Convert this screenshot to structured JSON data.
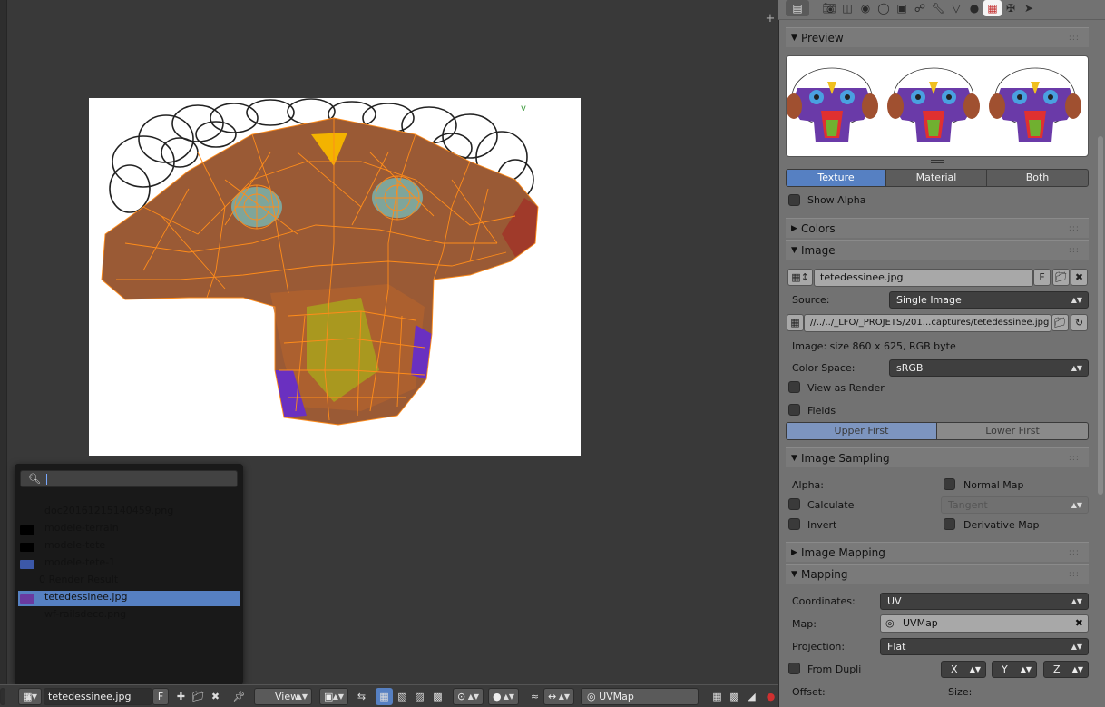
{
  "popup": {
    "items": [
      {
        "label": "doc20161215140459.png",
        "thumb": "none"
      },
      {
        "label": "modele-terrain",
        "thumb": "#000000"
      },
      {
        "label": "modele-tete",
        "thumb": "#000000"
      },
      {
        "label": "modele-tete-1",
        "thumb": "#3c58a8"
      },
      {
        "label": "0 Render Result",
        "thumb": "none"
      },
      {
        "label": "tetedessinee.jpg",
        "thumb": "#6a3aa0",
        "selected": true
      },
      {
        "label": "wf-railsdeco.png",
        "thumb": "none"
      }
    ]
  },
  "header": {
    "image_name": "tetedessinee.jpg",
    "fake_user": "F",
    "view_menu": "View",
    "uv_map": "UVMap"
  },
  "props": {
    "preview": {
      "title": "Preview",
      "tabs": [
        "Texture",
        "Material",
        "Both"
      ],
      "show_alpha": "Show Alpha"
    },
    "colors": {
      "title": "Colors"
    },
    "image": {
      "title": "Image",
      "name": "tetedessinee.jpg",
      "fake_user": "F",
      "source_label": "Source:",
      "source_value": "Single Image",
      "filepath": "//../../_LFO/_PROJETS/201...captures/tetedessinee.jpg",
      "info": "Image: size 860 x 625, RGB byte",
      "color_space_label": "Color Space:",
      "color_space_value": "sRGB",
      "view_as_render": "View as Render",
      "fields": "Fields",
      "field_order": [
        "Upper First",
        "Lower First"
      ]
    },
    "image_sampling": {
      "title": "Image Sampling",
      "alpha_label": "Alpha:",
      "normal_map": "Normal Map",
      "calculate": "Calculate",
      "tangent": "Tangent",
      "invert": "Invert",
      "derivative_map": "Derivative Map"
    },
    "image_mapping": {
      "title": "Image Mapping"
    },
    "mapping": {
      "title": "Mapping",
      "coordinates_label": "Coordinates:",
      "coordinates_value": "UV",
      "map_label": "Map:",
      "map_value": "UVMap",
      "projection_label": "Projection:",
      "projection_value": "Flat",
      "from_dupli": "From Dupli",
      "axes": [
        "X",
        "Y",
        "Z"
      ],
      "offset_label": "Offset:",
      "size_label": "Size:"
    }
  },
  "colors": {
    "accent": "#5680c2",
    "uv_edge": "#ff8c1a"
  }
}
